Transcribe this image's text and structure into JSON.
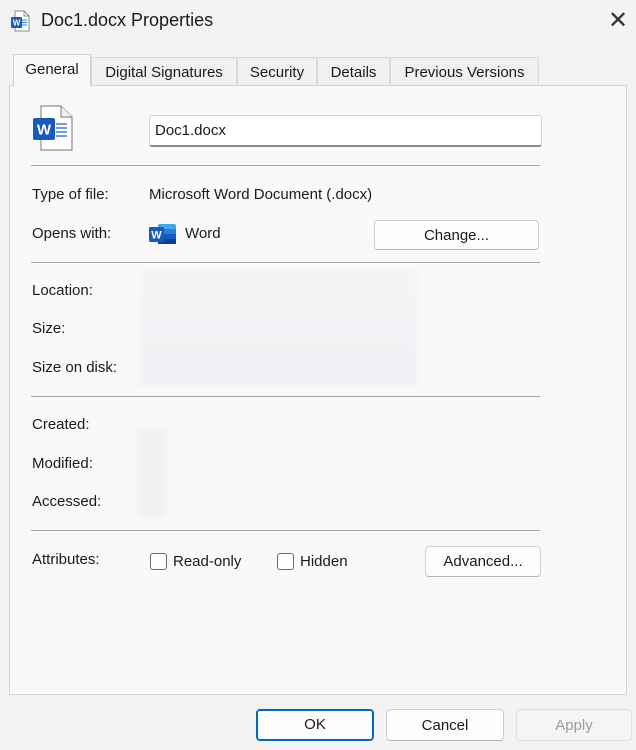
{
  "window": {
    "title": "Doc1.docx Properties",
    "close_glyph": "✕"
  },
  "tabs": [
    {
      "label": "General",
      "active": true
    },
    {
      "label": "Digital Signatures",
      "active": false
    },
    {
      "label": "Security",
      "active": false
    },
    {
      "label": "Details",
      "active": false
    },
    {
      "label": "Previous Versions",
      "active": false
    }
  ],
  "general": {
    "file_name": "Doc1.docx",
    "type_label": "Type of file:",
    "type_value": "Microsoft Word Document (.docx)",
    "opens_label": "Opens with:",
    "opens_value": "Word",
    "change_button": "Change...",
    "location_label": "Location:",
    "size_label": "Size:",
    "size_on_disk_label": "Size on disk:",
    "created_label": "Created:",
    "modified_label": "Modified:",
    "accessed_label": "Accessed:",
    "attributes_label": "Attributes:",
    "readonly_label": "Read-only",
    "readonly_checked": false,
    "hidden_label": "Hidden",
    "hidden_checked": false,
    "advanced_button": "Advanced..."
  },
  "footer": {
    "ok": "OK",
    "cancel": "Cancel",
    "apply": "Apply"
  },
  "icons": {
    "title": "word-document-icon",
    "file": "word-document-icon",
    "app": "word-app-icon"
  },
  "colors": {
    "word_blue": "#185abd",
    "accent": "#0067c0"
  }
}
